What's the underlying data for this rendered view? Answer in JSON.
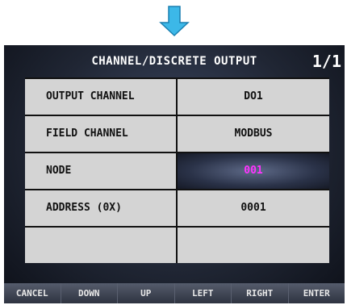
{
  "header": {
    "title": "CHANNEL/DISCRETE OUTPUT",
    "page": "1/1"
  },
  "rows": [
    {
      "label": "OUTPUT CHANNEL",
      "value": "DO1",
      "selected": false
    },
    {
      "label": "FIELD CHANNEL",
      "value": "MODBUS",
      "selected": false
    },
    {
      "label": "NODE",
      "value": "001",
      "selected": true
    },
    {
      "label": "ADDRESS (0X)",
      "value": "0001",
      "selected": false
    },
    {
      "label": "",
      "value": "",
      "selected": false
    }
  ],
  "softkeys": [
    "CANCEL",
    "DOWN",
    "UP",
    "LEFT",
    "RIGHT",
    "ENTER"
  ],
  "colors": {
    "arrow": "#3cb8e8",
    "selected_value": "#ff33ff",
    "cell": "#d4d4d4"
  }
}
